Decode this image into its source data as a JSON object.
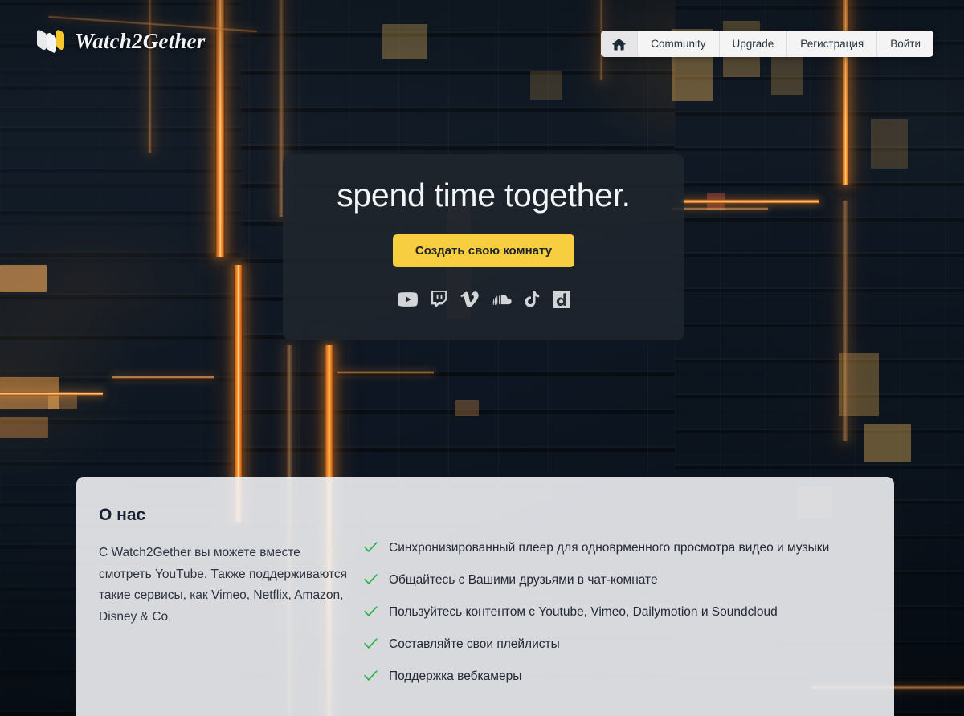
{
  "brand": {
    "name": "Watch2Gether",
    "logo_icon": "w2g-logo-icon",
    "logo_colors": [
      "#e9eaec",
      "#f2f3f5",
      "#f6c62a"
    ]
  },
  "nav": {
    "home_icon": "home-icon",
    "items": [
      {
        "label": "Community",
        "name": "nav-community"
      },
      {
        "label": "Upgrade",
        "name": "nav-upgrade"
      },
      {
        "label": "Регистрация",
        "name": "nav-register"
      },
      {
        "label": "Войти",
        "name": "nav-login"
      }
    ]
  },
  "hero": {
    "title": "spend time together.",
    "cta_label": "Создать свою комнату",
    "cta_color": "#f6ce3f",
    "panel_color": "rgba(32,38,45,0.88)",
    "services": [
      {
        "name": "youtube-icon",
        "label": "YouTube"
      },
      {
        "name": "twitch-icon",
        "label": "Twitch"
      },
      {
        "name": "vimeo-icon",
        "label": "Vimeo"
      },
      {
        "name": "soundcloud-icon",
        "label": "SoundCloud"
      },
      {
        "name": "tiktok-icon",
        "label": "TikTok"
      },
      {
        "name": "dailymotion-icon",
        "label": "Dailymotion"
      }
    ]
  },
  "about": {
    "title": "О нас",
    "description": "С Watch2Gether вы можете вместе смотреть YouTube. Также поддерживаются такие сервисы, как Vimeo, Netflix, Amazon, Disney & Co.",
    "check_color": "#2cb34a",
    "features": [
      "Синхронизированный плеер для одноврменного просмотра видео и музыки",
      "Общайтесь с Вашими друзьями в чат-комнате",
      "Пользуйтесь контентом с Youtube, Vimeo, Dailymotion и Soundcloud",
      "Составляйте свои плейлисты",
      "Поддержка вебкамеры"
    ]
  }
}
